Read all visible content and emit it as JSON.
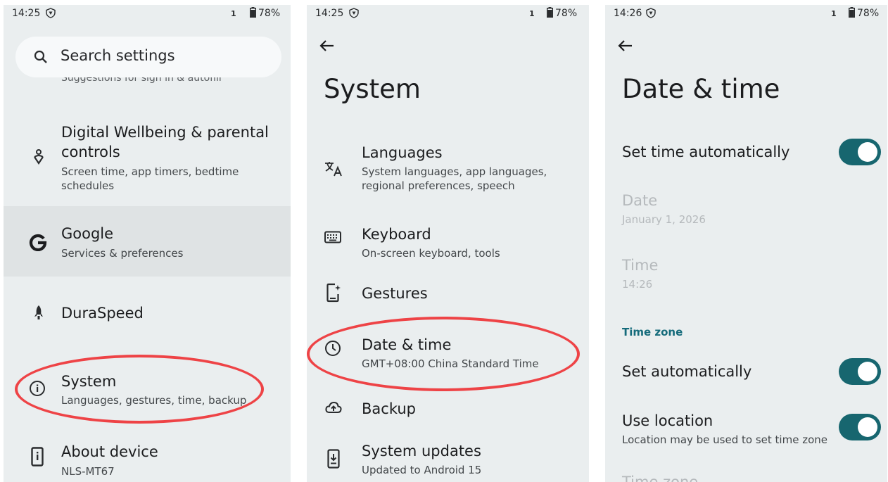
{
  "panel1": {
    "status": {
      "time": "14:25",
      "sim": "1",
      "battery": "78%"
    },
    "search": {
      "placeholder": "Search settings",
      "icon": "search-icon"
    },
    "cut_item": "Suggestions for sign in & autofill",
    "items": [
      {
        "title_line1": "Digital Wellbeing & parental",
        "title_line2": "controls",
        "sub_line1": "Screen time, app timers, bedtime",
        "sub_line2": "schedules",
        "icon": "wellbeing-icon"
      },
      {
        "title": "Google",
        "sub": "Services & preferences",
        "icon": "google-icon",
        "highlighted": true
      },
      {
        "title": "DuraSpeed",
        "icon": "rocket-icon"
      },
      {
        "title": "System",
        "sub": "Languages, gestures, time, backup",
        "icon": "info-icon",
        "circled": true
      },
      {
        "title": "About device",
        "sub": "NLS-MT67",
        "icon": "device-icon"
      }
    ]
  },
  "panel2": {
    "status": {
      "time": "14:25",
      "sim": "1",
      "battery": "78%"
    },
    "title": "System",
    "items": [
      {
        "title": "Languages",
        "sub_line1": "System languages, app languages,",
        "sub_line2": "regional preferences, speech",
        "icon": "translate-icon"
      },
      {
        "title": "Keyboard",
        "sub": "On-screen keyboard, tools",
        "icon": "keyboard-icon"
      },
      {
        "title": "Gestures",
        "icon": "gestures-icon"
      },
      {
        "title": "Date & time",
        "sub": "GMT+08:00 China Standard Time",
        "icon": "clock-icon",
        "circled": true
      },
      {
        "title": "Backup",
        "icon": "cloud-upload-icon"
      },
      {
        "title": "System updates",
        "sub": "Updated to Android 15",
        "icon": "system-update-icon"
      }
    ]
  },
  "panel3": {
    "status": {
      "time": "14:26",
      "sim": "1",
      "battery": "78%"
    },
    "title": "Date & time",
    "set_time_auto": {
      "title": "Set time automatically",
      "on": true
    },
    "date": {
      "title": "Date",
      "value": "January 1, 2026"
    },
    "time": {
      "title": "Time",
      "value": "14:26"
    },
    "time_zone_header": "Time zone",
    "set_auto": {
      "title": "Set automatically",
      "on": true
    },
    "use_location": {
      "title": "Use location",
      "sub": "Location may be used to set time zone",
      "on": true
    },
    "cut_item": "Time zone"
  },
  "colors": {
    "panel_bg": "#eaeeef",
    "highlight_bg": "#dfe3e4",
    "toggle_on": "#17666f",
    "accent_text": "#156b7b",
    "annotation_red": "#ee4346"
  }
}
